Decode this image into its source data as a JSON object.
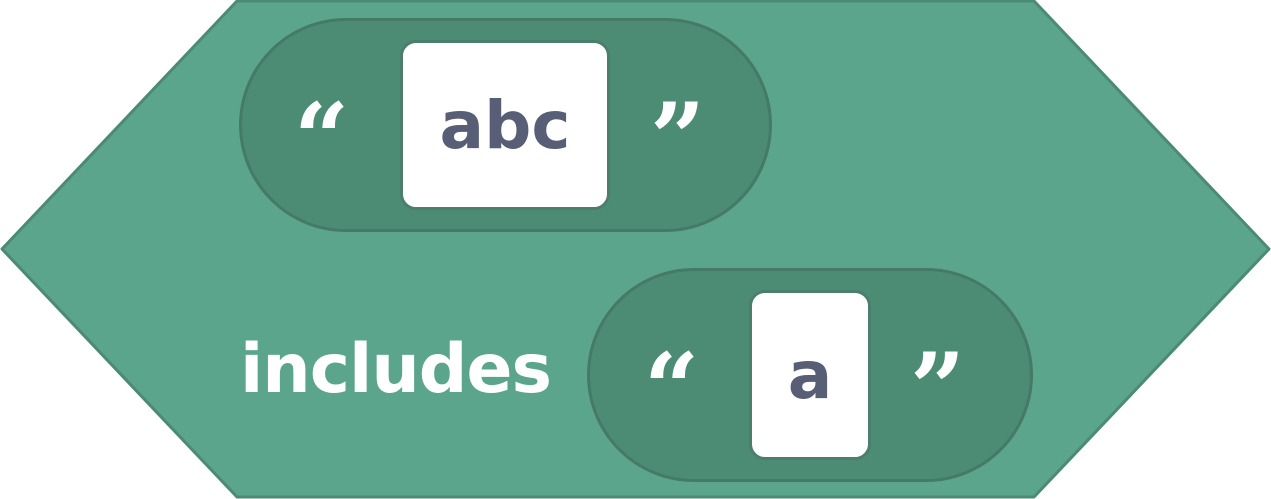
{
  "block": {
    "type": "operator-contains",
    "category_color": "#5ba58c",
    "inner_color": "#4c8b74",
    "label": "includes",
    "input_1": {
      "open_quote": "“",
      "value": "abc",
      "close_quote": "”"
    },
    "input_2": {
      "open_quote": "“",
      "value": "a",
      "close_quote": "”"
    }
  }
}
